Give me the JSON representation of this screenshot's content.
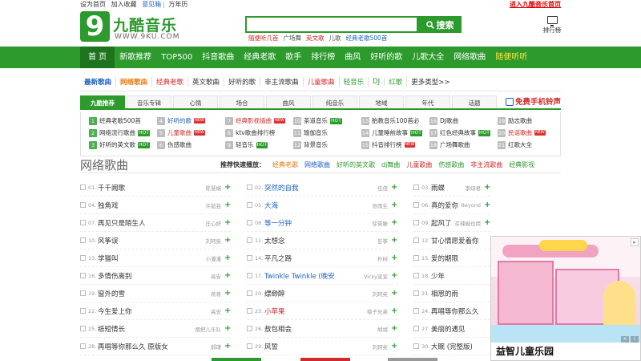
{
  "util": {
    "items": [
      "设为首页",
      "加入收藏",
      "意见箱",
      "万年历"
    ],
    "right_link": "进入九酷音乐首页"
  },
  "logo": {
    "mark": "9",
    "title": "九酷音乐",
    "url": "WWW.9KU.COM"
  },
  "search": {
    "value": "",
    "button": "搜索",
    "hot_words": [
      "随便听几首",
      "广场舞",
      "英文歌",
      "儿歌",
      "经典老歌500首"
    ]
  },
  "chart_link": "排行榜",
  "nav": {
    "items": [
      "首 页",
      "新歌推荐",
      "TOP500",
      "抖音歌曲",
      "经典老歌",
      "歌手",
      "排行榜",
      "曲风",
      "好听的歌",
      "儿歌大全",
      "网络歌曲",
      "随便听听"
    ]
  },
  "categories": [
    "最新歌曲",
    "网络歌曲",
    "经典老歌",
    "英文歌曲",
    "好听的歌",
    "非主流歌曲",
    "儿童歌曲",
    "轻音乐",
    "DJ",
    "红歌",
    "更多类型>>"
  ],
  "tabs": {
    "items": [
      "九酷推荐",
      "音乐专辑",
      "心情",
      "场合",
      "曲风",
      "纯音乐",
      "地域",
      "年代",
      "话题"
    ],
    "ring": "免费手机铃声"
  },
  "charts": [
    {
      "n": "1",
      "t": "经典老歌500首",
      "b": ""
    },
    {
      "n": "4",
      "t": "好听的歌",
      "b": "NEW"
    },
    {
      "n": "7",
      "t": "经典影视插曲",
      "b": "NEW"
    },
    {
      "n": "10",
      "t": "茶道音乐",
      "b": "HOT"
    },
    {
      "n": "13",
      "t": "胎教音乐100首必",
      "b": ""
    },
    {
      "n": "16",
      "t": "DJ歌曲",
      "b": ""
    },
    {
      "n": "19",
      "t": "励志歌曲",
      "b": ""
    },
    {
      "n": "2",
      "t": "网络流行歌曲",
      "b": "HOT"
    },
    {
      "n": "5",
      "t": "儿童歌曲",
      "b": "NEW"
    },
    {
      "n": "8",
      "t": "ktv歌曲排行榜",
      "b": ""
    },
    {
      "n": "11",
      "t": "瑜伽音乐",
      "b": ""
    },
    {
      "n": "14",
      "t": "儿童睡前故事",
      "b": "HOT"
    },
    {
      "n": "17",
      "t": "红色经典故事",
      "b": "HOT"
    },
    {
      "n": "20",
      "t": "民谣歌曲",
      "b": "NEW"
    },
    {
      "n": "3",
      "t": "好听的英文歌",
      "b": "HOT"
    },
    {
      "n": "6",
      "t": "伤感歌曲",
      "b": ""
    },
    {
      "n": "9",
      "t": "轻音乐",
      "b": "HOT"
    },
    {
      "n": "12",
      "t": "背景音乐",
      "b": ""
    },
    {
      "n": "15",
      "t": "抖音排行榜",
      "b": "NEW"
    },
    {
      "n": "18",
      "t": "广场舞歌曲",
      "b": ""
    },
    {
      "n": "21",
      "t": "红歌大全",
      "b": ""
    }
  ],
  "section": {
    "title": "网络歌曲",
    "quick_label": "推荐快速播放：",
    "quick": [
      "经典老歌",
      "网络歌曲",
      "好听的英文歌",
      "dj舞曲",
      "儿童歌曲",
      "伤感歌曲",
      "非主流歌曲",
      "经典影视"
    ]
  },
  "songs": {
    "col1": [
      {
        "n": "01.",
        "t": "千千阙歌",
        "a": "陈慧娴",
        "c": ""
      },
      {
        "n": "04.",
        "t": "独角戏",
        "a": "许茹芸",
        "c": ""
      },
      {
        "n": "07.",
        "t": "再见只是陌生人",
        "a": "庄心妍",
        "c": ""
      },
      {
        "n": "10.",
        "t": "风筝误",
        "a": "刘珂矣",
        "c": ""
      },
      {
        "n": "13.",
        "t": "学猫叫",
        "a": "小潘潘",
        "c": ""
      },
      {
        "n": "16.",
        "t": "多情伤离别",
        "a": "高安",
        "c": ""
      },
      {
        "n": "19.",
        "t": "窗外的雪",
        "a": "蒋蒋",
        "c": ""
      },
      {
        "n": "22.",
        "t": "今生爱上你",
        "a": "高安",
        "c": ""
      },
      {
        "n": "25.",
        "t": "纸短情长",
        "a": "烟把儿乐队",
        "c": ""
      },
      {
        "n": "28.",
        "t": "再唱等你那么久 原版女",
        "a": "郝瑾",
        "c": ""
      }
    ],
    "col2": [
      {
        "n": "02.",
        "t": "突然的自我",
        "a": "伍佰",
        "c": "blue"
      },
      {
        "n": "05.",
        "t": "大海",
        "a": "张雨生",
        "c": "blue"
      },
      {
        "n": "08.",
        "t": "等一分钟",
        "a": "徐誉滕",
        "c": "blue"
      },
      {
        "n": "11.",
        "t": "太想念",
        "a": "彭筝",
        "c": ""
      },
      {
        "n": "14.",
        "t": "平凡之路",
        "a": "朴树",
        "c": ""
      },
      {
        "n": "17.",
        "t": "Twinkle Twinkle (晚安",
        "a": "Vicky宣宣",
        "c": "blue"
      },
      {
        "n": "20.",
        "t": "缥缈醉",
        "a": "刘珂矣",
        "c": ""
      },
      {
        "n": "23.",
        "t": "小苹果",
        "a": "筷子兄弟",
        "c": "red"
      },
      {
        "n": "26.",
        "t": "敖包相会",
        "a": "胡斌",
        "c": ""
      },
      {
        "n": "29.",
        "t": "风誓",
        "a": "刘珂矣",
        "c": ""
      }
    ],
    "col3": [
      {
        "n": "03.",
        "t": "雨蝶",
        "a": "李翊君",
        "c": ""
      },
      {
        "n": "06.",
        "t": "真的爱你",
        "a": "Beyond",
        "c": ""
      },
      {
        "n": "09.",
        "t": "起风了",
        "a": "买辣椒也用",
        "c": ""
      },
      {
        "n": "12.",
        "t": "甘心情愿爱着你",
        "a": "",
        "c": ""
      },
      {
        "n": "15.",
        "t": "爱的期限",
        "a": "",
        "c": ""
      },
      {
        "n": "18.",
        "t": "少年",
        "a": "",
        "c": ""
      },
      {
        "n": "21.",
        "t": "相思的雨",
        "a": "",
        "c": ""
      },
      {
        "n": "24.",
        "t": "再唱等你那么久",
        "a": "",
        "c": ""
      },
      {
        "n": "27.",
        "t": "美丽的遇见",
        "a": "",
        "c": ""
      },
      {
        "n": "30.",
        "t": "大眠 (完整版)",
        "a": "",
        "c": ""
      }
    ]
  },
  "ad": {
    "caption": "益智儿童乐园"
  },
  "colors": {
    "brand_green": "#2c9a2c",
    "accent_red": "#d02a2a",
    "link_blue": "#1e63c4"
  }
}
